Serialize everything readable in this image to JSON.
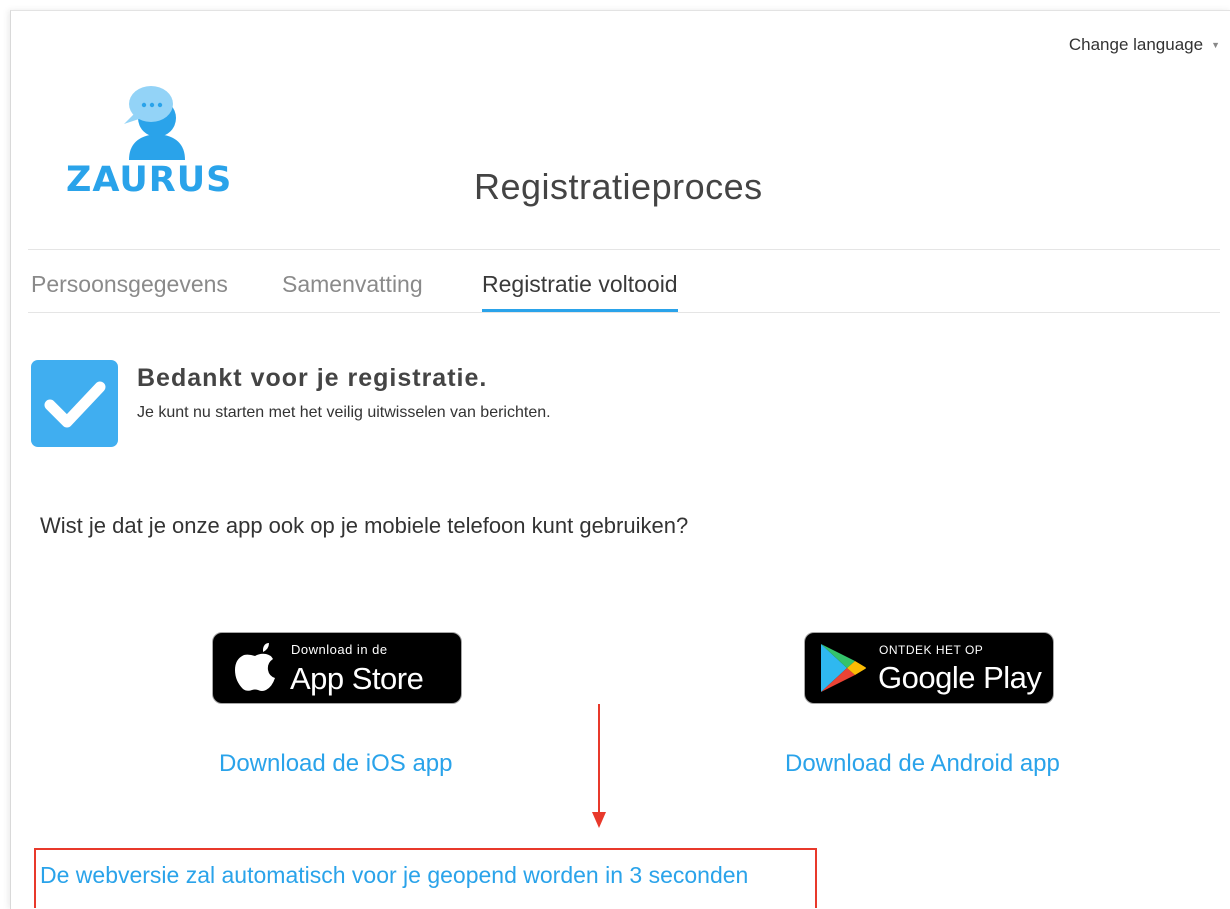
{
  "header": {
    "change_language": "Change language",
    "brand": "ZAURUS",
    "title": "Registratieproces"
  },
  "tabs": [
    {
      "label": "Persoonsgegevens",
      "active": false
    },
    {
      "label": "Samenvatting",
      "active": false
    },
    {
      "label": "Registratie voltooid",
      "active": true
    }
  ],
  "confirmation": {
    "title": "Bedankt voor je registratie.",
    "subtitle": "Je kunt nu starten met het veilig uitwisselen van berichten."
  },
  "app_promo": {
    "question": "Wist je dat je onze app ook op je mobiele telefoon kunt gebruiken?",
    "apple_badge": {
      "small": "Download in de",
      "big": "App Store"
    },
    "google_badge": {
      "small": "ONTDEK HET OP",
      "big": "Google Play"
    },
    "ios_link": "Download de iOS app",
    "android_link": "Download de Android app"
  },
  "redirect_notice": "De webversie zal automatisch voor je geopend worden in 3 seconden",
  "colors": {
    "accent": "#2aa3ea",
    "annotation": "#e8392b",
    "check_bg": "#40aef0"
  },
  "icons": [
    "chevron-down-icon",
    "zaurus-logo-icon",
    "checkmark-icon",
    "apple-icon",
    "google-play-icon",
    "arrow-down-icon"
  ]
}
